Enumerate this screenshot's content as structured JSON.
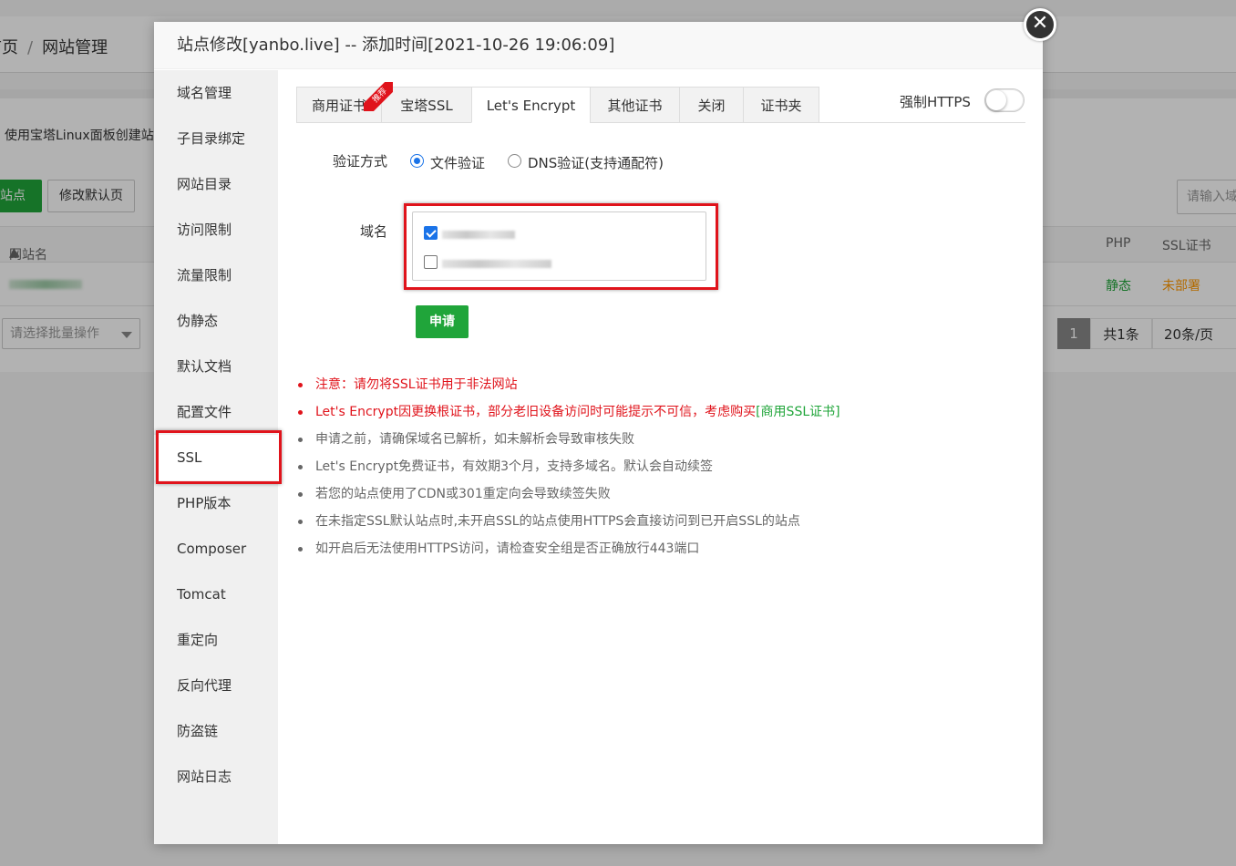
{
  "background": {
    "breadcrumb": [
      "首页",
      "网站管理"
    ],
    "description": "使用宝塔Linux面板创建站",
    "add_site_btn": "添加站点",
    "modify_default_btn": "修改默认页",
    "search_placeholder": "请输入域名",
    "table_headers": {
      "site_name": "网站名",
      "php": "PHP",
      "ssl": "SSL证书"
    },
    "row": {
      "php": "静态",
      "ssl": "未部署"
    },
    "batch_placeholder": "请选择批量操作",
    "pager": {
      "current": "1",
      "total": "共1条",
      "page_size": "20条/页"
    }
  },
  "modal": {
    "title": "站点修改[yanbo.live] -- 添加时间[2021-10-26 19:06:09]",
    "close_glyph": "✕",
    "sidebar": [
      "域名管理",
      "子目录绑定",
      "网站目录",
      "访问限制",
      "流量限制",
      "伪静态",
      "默认文档",
      "配置文件",
      "SSL",
      "PHP版本",
      "Composer",
      "Tomcat",
      "重定向",
      "反向代理",
      "防盗链",
      "网站日志"
    ],
    "active_sidebar": "SSL",
    "tabs": [
      "商用证书",
      "宝塔SSL",
      "Let's Encrypt",
      "其他证书",
      "关闭",
      "证书夹"
    ],
    "active_tab": "Let's Encrypt",
    "ribbon": "推荐",
    "force_https_label": "强制HTTPS",
    "force_https_on": false,
    "verify_label": "验证方式",
    "verify_options": [
      "文件验证",
      "DNS验证(支持通配符)"
    ],
    "verify_selected": "文件验证",
    "domain_label": "域名",
    "domains": [
      {
        "checked": true
      },
      {
        "checked": false
      }
    ],
    "apply_btn": "申请",
    "notes": [
      {
        "text": "注意：请勿将SSL证书用于非法网站",
        "color": "red"
      },
      {
        "text": "Let's Encrypt因更换根证书，部分老旧设备访问时可能提示不可信，考虑购买",
        "link": "[商用SSL证书]",
        "color": "red"
      },
      {
        "text": "申请之前，请确保域名已解析，如未解析会导致审核失败",
        "color": "gray"
      },
      {
        "text": "Let's Encrypt免费证书，有效期3个月，支持多域名。默认会自动续签",
        "color": "gray"
      },
      {
        "text": "若您的站点使用了CDN或301重定向会导致续签失败",
        "color": "gray"
      },
      {
        "text": "在未指定SSL默认站点时,未开启SSL的站点使用HTTPS会直接访问到已开启SSL的站点",
        "color": "gray"
      },
      {
        "text": "如开启后无法使用HTTPS访问，请检查安全组是否正确放行443端口",
        "color": "gray"
      }
    ]
  }
}
